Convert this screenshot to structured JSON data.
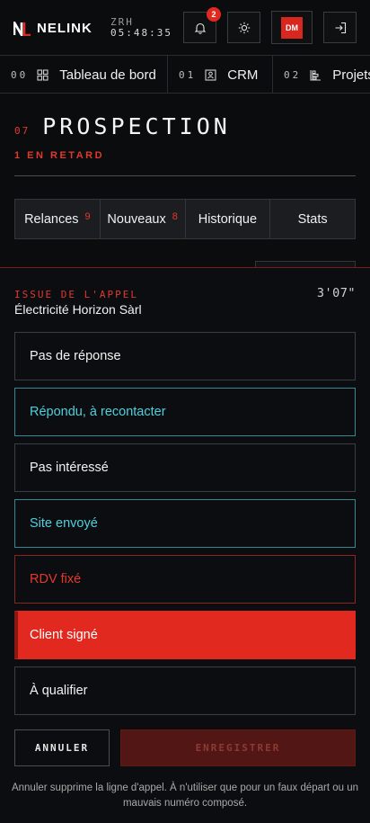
{
  "header": {
    "brand": "NELINK",
    "clock_city": "ZRH",
    "clock_time": "05:48:35",
    "notifications_count": "2",
    "avatar_initials": "DM",
    "icons": [
      "bell-icon",
      "sun-icon",
      "logout-icon"
    ],
    "accent": "#e2291f"
  },
  "nav": {
    "items": [
      {
        "num": "00",
        "label": "Tableau de bord",
        "icon": "dashboard-icon"
      },
      {
        "num": "01",
        "label": "CRM",
        "icon": "contact-card-icon"
      },
      {
        "num": "02",
        "label": "Projets",
        "icon": "bar-chart-icon"
      }
    ]
  },
  "page": {
    "number": "07",
    "title": "PROSPECTION",
    "late_label": "1 EN RETARD"
  },
  "tabs": [
    {
      "label": "Relances",
      "count": "9"
    },
    {
      "label": "Nouveaux",
      "count": "8"
    },
    {
      "label": "Historique",
      "count": ""
    },
    {
      "label": "Stats",
      "count": ""
    }
  ],
  "sheet": {
    "label": "ISSUE DE L'APPEL",
    "company": "Électricité Horizon Sàrl",
    "duration": "3'07\"",
    "options": [
      {
        "label": "Pas de réponse",
        "style": "default"
      },
      {
        "label": "Répondu, à recontacter",
        "style": "cyan"
      },
      {
        "label": "Pas intéressé",
        "style": "default"
      },
      {
        "label": "Site envoyé",
        "style": "cyan"
      },
      {
        "label": "RDV fixé",
        "style": "red"
      },
      {
        "label": "Client signé",
        "style": "selected"
      },
      {
        "label": "À qualifier",
        "style": "default"
      }
    ],
    "cancel_label": "ANNULER",
    "save_label": "ENREGISTRER",
    "note": "Annuler supprime la ligne d'appel. À n'utiliser que pour un faux départ ou un mauvais numéro composé."
  }
}
